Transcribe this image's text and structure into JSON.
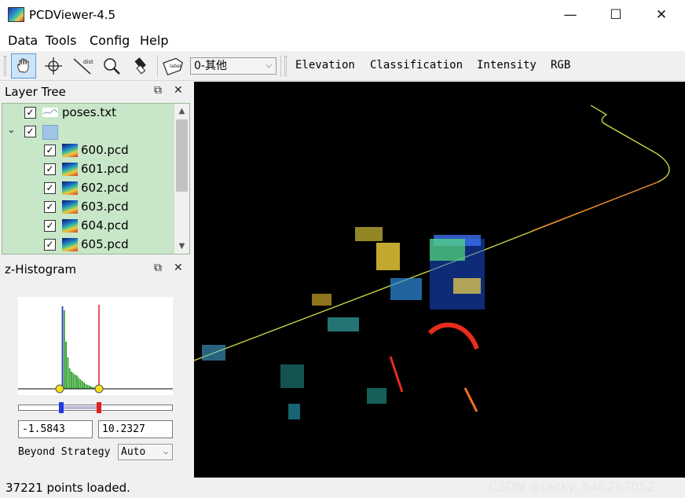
{
  "window": {
    "title": "PCDViewer-4.5",
    "minimize_glyph": "—",
    "maximize_glyph": "☐",
    "close_glyph": "✕"
  },
  "menu": [
    "Data",
    "Tools",
    "Config",
    "Help"
  ],
  "toolbar": {
    "icons": [
      "hand-icon",
      "crosshair-icon",
      "distance-icon",
      "zoom-icon",
      "pick-icon",
      "label-icon"
    ],
    "distance_icon_text": "dist",
    "label_icon_text": "label",
    "label_combo_value": "0-其他",
    "color_modes": [
      "Elevation",
      "Classification",
      "Intensity",
      "RGB"
    ]
  },
  "layer_tree": {
    "title": "Layer Tree",
    "items": [
      {
        "label": "poses.txt",
        "checked": true
      },
      {
        "label": "",
        "checked": true,
        "group": true
      },
      {
        "label": "600.pcd",
        "checked": true
      },
      {
        "label": "601.pcd",
        "checked": true
      },
      {
        "label": "602.pcd",
        "checked": true
      },
      {
        "label": "603.pcd",
        "checked": true
      },
      {
        "label": "604.pcd",
        "checked": true
      },
      {
        "label": "605.pcd",
        "checked": true
      }
    ]
  },
  "histogram": {
    "title": "z-Histogram",
    "min_value": "-1.5843",
    "max_value": "10.2327",
    "beyond_strategy_label": "Beyond Strategy",
    "beyond_strategy_value": "Auto",
    "range_low_fraction": 0.27,
    "range_high_fraction": 0.52
  },
  "status": {
    "text": "37221 points loaded.",
    "watermark": "CSDN @Jacky_546287052"
  },
  "colors": {
    "tree_background": "#c8e6c8",
    "viewport_background": "#000000",
    "histogram_bars": "#2ea02e",
    "lower_marker": "#1f3be0",
    "upper_marker": "#e01f1f"
  }
}
